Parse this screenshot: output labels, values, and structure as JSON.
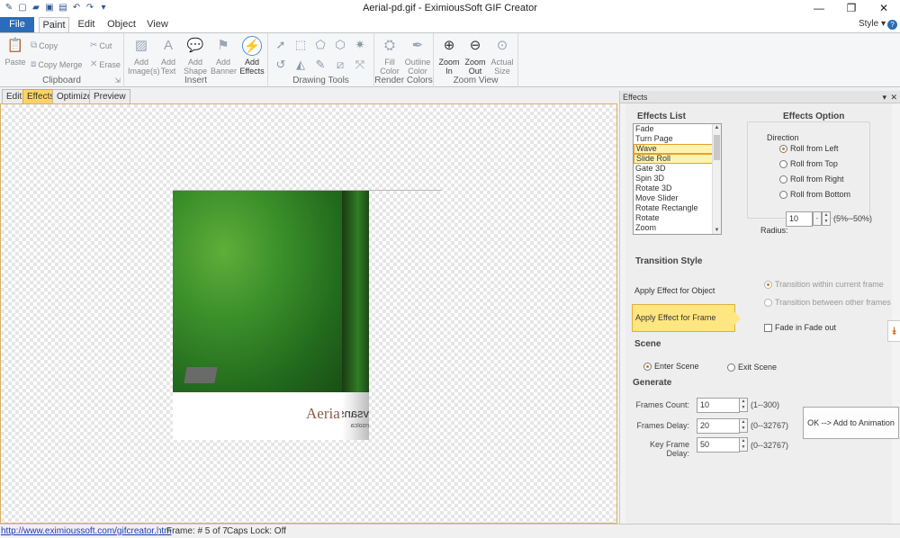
{
  "window": {
    "title": "Aerial-pd.gif - EximiousSoft GIF Creator",
    "style_menu": "Style",
    "help": "?"
  },
  "ribbon": {
    "tabs": [
      "File",
      "Paint",
      "Edit",
      "Object",
      "View"
    ],
    "groups": {
      "clipboard": {
        "label": "Clipboard",
        "paste": "Paste",
        "copy": "Copy",
        "copy_merge": "Copy Merge",
        "cut": "Cut",
        "erase": "Erase"
      },
      "insert": {
        "label": "Insert",
        "add_images": "Add Image(s)",
        "add_text": "Add Text",
        "add_shape": "Add Shape",
        "add_banner": "Add Banner",
        "add_effects": "Add Effects"
      },
      "drawing": {
        "label": "Drawing Tools"
      },
      "render": {
        "label": "Render Colors",
        "fill": "Fill Color",
        "outline": "Outline Color"
      },
      "zoom": {
        "label": "Zoom View",
        "zoom_in": "Zoom In",
        "zoom_out": "Zoom Out",
        "actual": "Actual Size"
      }
    }
  },
  "canvas": {
    "tabs": [
      "Edit",
      "Effects",
      "Optimize",
      "Preview"
    ],
    "frame_text": "Aeria",
    "frame_text_mirror": "vsans",
    "frame_text_mirror2": "nsolca"
  },
  "status": {
    "link": "http://www.eximioussoft.com/gifcreator.htm",
    "frame": "Frame: # 5 of 7",
    "caps": "Caps Lock: Off"
  },
  "effects_panel": {
    "title": "Effects",
    "effects_list_title": "Effects List",
    "effects": [
      "Fade",
      "Turn Page",
      "Wave",
      "Slide Roll",
      "Gate 3D",
      "Spin 3D",
      "Rotate 3D",
      "Move Slider",
      "Rotate Rectangle",
      "Rotate",
      "Zoom"
    ],
    "selected_effects": [
      "Wave",
      "Slide Roll"
    ],
    "option_title": "Effects Option",
    "direction_label": "Direction",
    "directions": [
      "Roll from Left",
      "Roll from Top",
      "Roll from Right",
      "Roll from Bottom"
    ],
    "direction_selected": "Roll from Left",
    "radius_label": "Radius:",
    "radius_value": "10",
    "radius_range": "(5%--50%)",
    "transition_title": "Transition Style",
    "apply_object": "Apply Effect for Object",
    "apply_frame": "Apply Effect  for Frame",
    "within_frame": "Transition within current frame",
    "between_frames": "Transition between other frames",
    "fade": "Fade in Fade out",
    "scene_title": "Scene",
    "enter_scene": "Enter Scene",
    "exit_scene": "Exit Scene",
    "generate_title": "Generate",
    "frames_count_label": "Frames Count:",
    "frames_count_value": "10",
    "frames_count_range": "(1--300)",
    "frames_delay_label": "Frames Delay:",
    "frames_delay_value": "20",
    "frames_delay_range": "(0--32767)",
    "key_delay_label": "Key Frame Delay:",
    "key_delay_value": "50",
    "key_delay_range": "(0--32767)",
    "ok_button": "OK --> Add to Animation"
  }
}
